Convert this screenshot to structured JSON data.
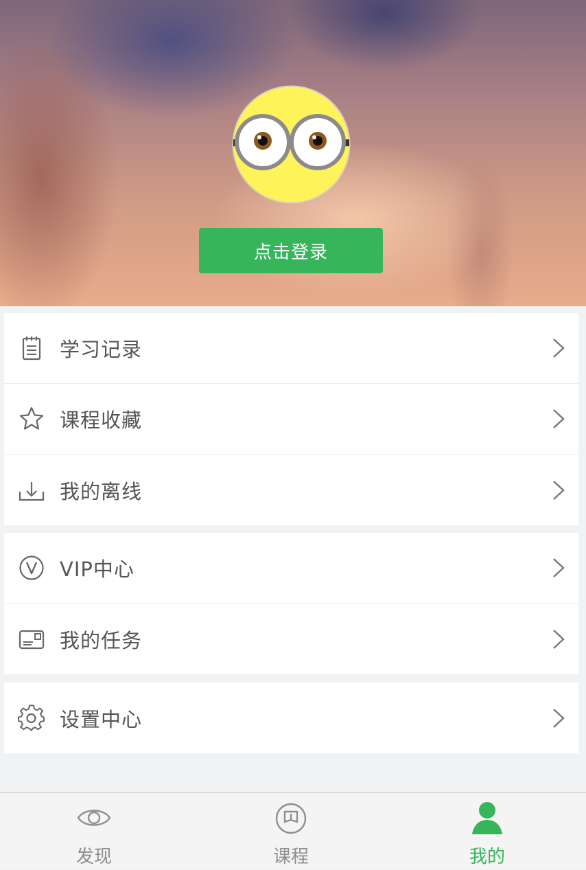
{
  "header": {
    "login_button": "点击登录"
  },
  "menu": {
    "group1": [
      {
        "label": "学习记录",
        "icon": "notepad-icon"
      },
      {
        "label": "课程收藏",
        "icon": "star-icon"
      },
      {
        "label": "我的离线",
        "icon": "download-icon"
      }
    ],
    "group2": [
      {
        "label": "VIP中心",
        "icon": "vip-icon"
      },
      {
        "label": "我的任务",
        "icon": "task-card-icon"
      }
    ],
    "group3": [
      {
        "label": "设置中心",
        "icon": "gear-icon"
      }
    ]
  },
  "tabbar": {
    "tabs": [
      {
        "label": "发现",
        "icon": "eye-icon",
        "active": false
      },
      {
        "label": "课程",
        "icon": "book-icon",
        "active": false
      },
      {
        "label": "我的",
        "icon": "person-icon",
        "active": true
      }
    ]
  },
  "colors": {
    "accent": "#36b55b",
    "text": "#555555",
    "inactive_tab": "#8e8e8e",
    "background": "#f1f2f4"
  }
}
